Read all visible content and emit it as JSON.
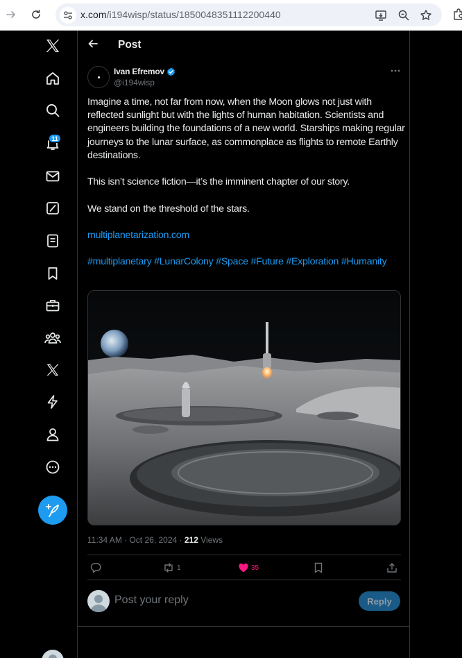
{
  "browser": {
    "url_host": "x.com",
    "url_path": "/i194wisp/status/1850048351112200440"
  },
  "nav": {
    "notifications_badge": "11"
  },
  "header": {
    "title": "Post"
  },
  "post": {
    "author_name": "Ivan Efremov",
    "author_handle": "@i194wisp",
    "paragraphs": [
      "Imagine a time, not far from now, when the Moon glows not just with reflected sunlight but with the lights of human habitation. Scientists and engineers building the foundations of a new world. Starships making regular journeys to the lunar surface, as commonplace as flights to remote Earthly destinations.",
      "This isn’t science fiction—it’s the imminent chapter of our story.",
      "We stand on the threshold of the stars."
    ],
    "link": "multiplanetarization.com",
    "hashtags": "#multiplanetary #LunarColony #Space #Future #Exploration #Humanity",
    "timestamp": "11:34 AM · Oct 26, 2024",
    "views_count": "212",
    "views_label": "Views",
    "reposts": "1",
    "likes": "35"
  },
  "reply": {
    "placeholder": "Post your reply",
    "button_label": "Reply"
  },
  "colors": {
    "accent": "#1d9bf0",
    "like": "#f91880",
    "border": "#2f3336",
    "secondary_text": "#71767b"
  }
}
